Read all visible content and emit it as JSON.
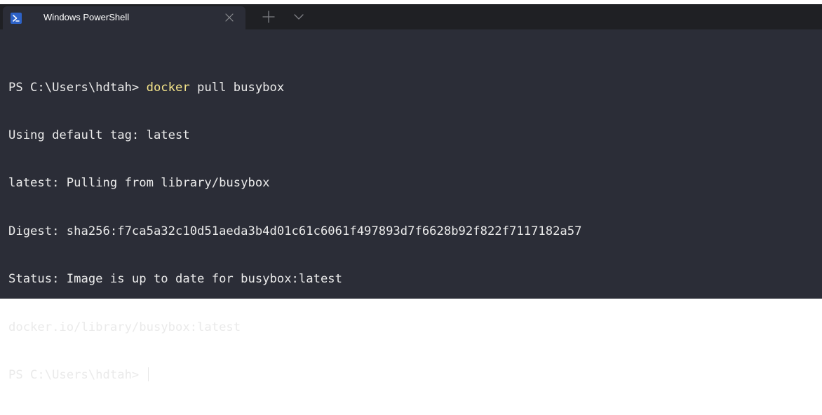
{
  "tab": {
    "title": "Windows PowerShell",
    "icon": "powershell-icon",
    "close_icon": "close-icon",
    "new_tab_icon": "plus-icon",
    "dropdown_icon": "chevron-down-icon"
  },
  "colors": {
    "tabstrip_bg": "#1f2024",
    "terminal_bg": "#2b2d37",
    "text": "#eaeaea",
    "command_highlight": "#f5e58a",
    "icon_blue": "#2d62c7"
  },
  "terminal": {
    "prompt1": "PS C:\\Users\\hdtah> ",
    "cmd_word": "docker",
    "cmd_rest": " pull busybox",
    "lines": [
      "Using default tag: latest",
      "latest: Pulling from library/busybox",
      "Digest: sha256:f7ca5a32c10d51aeda3b4d01c61c6061f497893d7f6628b92f822f7117182a57",
      "Status: Image is up to date for busybox:latest",
      "docker.io/library/busybox:latest"
    ],
    "prompt2": "PS C:\\Users\\hdtah> "
  }
}
